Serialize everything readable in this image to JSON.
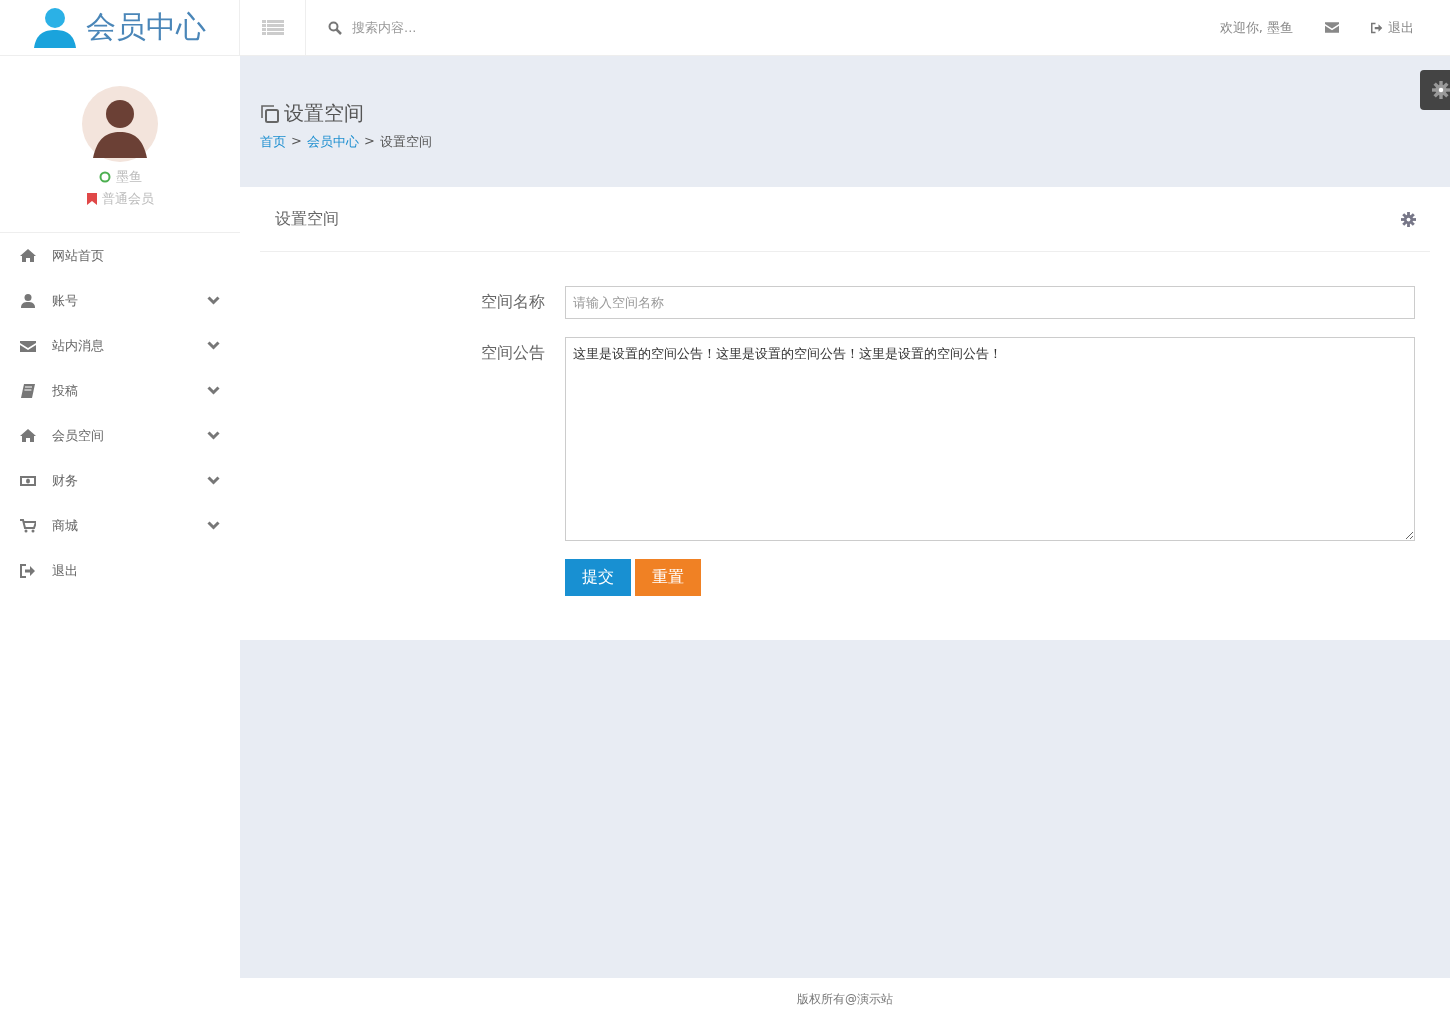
{
  "header": {
    "logo": "会员中心",
    "search": {
      "placeholder": "搜索内容..."
    },
    "welcome": "欢迎你, 墨鱼",
    "logout": "退出"
  },
  "profile": {
    "name": "墨鱼",
    "online": true,
    "level": "普通会员"
  },
  "sidebar": {
    "items": [
      {
        "label": "网站首页",
        "has_submenu": false
      },
      {
        "label": "账号",
        "has_submenu": true
      },
      {
        "label": "站内消息",
        "has_submenu": true
      },
      {
        "label": "投稿",
        "has_submenu": true
      },
      {
        "label": "会员空间",
        "has_submenu": true
      },
      {
        "label": "财务",
        "has_submenu": true
      },
      {
        "label": "商城",
        "has_submenu": true
      },
      {
        "label": "退出",
        "has_submenu": false
      }
    ]
  },
  "page": {
    "title": "设置空间",
    "breadcrumb": [
      {
        "kind": "link",
        "label": "首页"
      },
      {
        "kind": "separator",
        "label": ">"
      },
      {
        "kind": "link",
        "label": "会员中心"
      },
      {
        "kind": "separator",
        "label": ">"
      },
      {
        "kind": "current",
        "label": "设置空间"
      }
    ]
  },
  "card": {
    "title": "设置空间",
    "fields": [
      {
        "kind": "input",
        "label": "空间名称",
        "placeholder": "请输入空间名称"
      },
      {
        "kind": "textarea",
        "label": "空间公告",
        "value": "这里是设置的空间公告！这里是设置的空间公告！这里是设置的空间公告！"
      }
    ],
    "buttons": [
      {
        "label": "提交",
        "kind": "primary"
      },
      {
        "label": "重置",
        "kind": "warning"
      }
    ]
  },
  "footer": "版权所有@演示站"
}
